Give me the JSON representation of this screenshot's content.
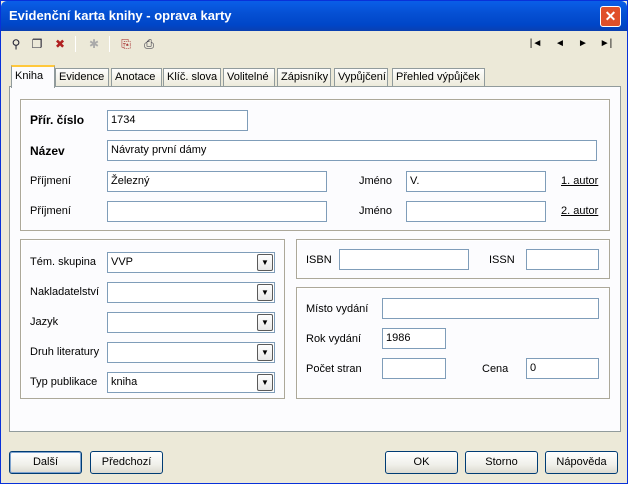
{
  "window": {
    "title": "Evidenční karta knihy - oprava karty",
    "close": "✕"
  },
  "toolbar": {
    "icons": [
      "binoculars-icon",
      "copy-card-icon",
      "delete-card-icon",
      "settings-icon",
      "export-icon",
      "print-icon"
    ],
    "nav": {
      "first": "|◄",
      "prev": "◄",
      "next": "►",
      "last": "►|"
    }
  },
  "tabs": [
    "Kniha",
    "Evidence",
    "Anotace",
    "Klíč. slova",
    "Volitelné",
    "Zápisníky",
    "Vypůjčení",
    "Přehled výpůjček"
  ],
  "kniha": {
    "pric_cislo": {
      "label": "Přír. číslo",
      "value": "1734"
    },
    "nazev": {
      "label": "Název",
      "value": "Návraty první dámy"
    },
    "author1": {
      "prijmeni_label": "Příjmení",
      "prijmeni": "Železný",
      "jmeno_label": "Jméno",
      "jmeno": "V.",
      "link": "1. autor"
    },
    "author2": {
      "prijmeni_label": "Příjmení",
      "prijmeni": "",
      "jmeno_label": "Jméno",
      "jmeno": "",
      "link": "2. autor"
    },
    "tem_skupina": {
      "label": "Tém. skupina",
      "value": "VVP"
    },
    "nakladatelstvi": {
      "label": "Nakladatelství",
      "value": ""
    },
    "jazyk": {
      "label": "Jazyk",
      "value": ""
    },
    "druh_literatury": {
      "label": "Druh literatury",
      "value": ""
    },
    "typ_publikace": {
      "label": "Typ publikace",
      "value": "kniha"
    },
    "isbn": {
      "label": "ISBN",
      "value": ""
    },
    "issn": {
      "label": "ISSN",
      "value": ""
    },
    "misto_vydani": {
      "label": "Místo vydání",
      "value": ""
    },
    "rok_vydani": {
      "label": "Rok vydání",
      "value": "1986"
    },
    "pocet_stran": {
      "label": "Počet stran",
      "value": ""
    },
    "cena": {
      "label": "Cena",
      "value": "0"
    }
  },
  "buttons": {
    "dalsi": "Další",
    "predchozi": "Předchozí",
    "ok": "OK",
    "storno": "Storno",
    "napoveda": "Nápověda"
  }
}
